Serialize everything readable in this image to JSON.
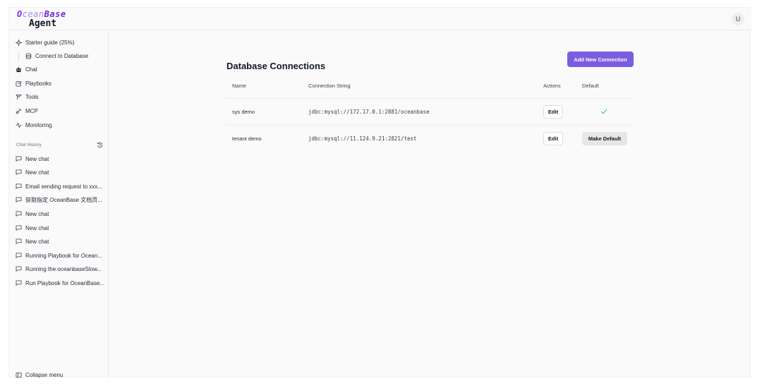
{
  "brand": {
    "logo_part1": "O",
    "logo_part2": "cean",
    "logo_part3": "Base",
    "logo_sub": "Agent",
    "accent": "#7c5ce0"
  },
  "user": {
    "avatar_initial": "U"
  },
  "sidebar": {
    "nav": [
      {
        "label": "Starter guide (25%)",
        "icon": "sparkle-icon"
      },
      {
        "label": "Connect to Database",
        "icon": "database-icon"
      },
      {
        "label": "Chat",
        "icon": "bot-icon"
      },
      {
        "label": "Playbooks",
        "icon": "playbook-icon"
      },
      {
        "label": "Tools",
        "icon": "tools-icon"
      },
      {
        "label": "MCP",
        "icon": "plug-icon"
      },
      {
        "label": "Monitoring",
        "icon": "activity-icon"
      }
    ],
    "history_label": "Chat History",
    "history": [
      "New chat",
      "New chat",
      "Email sending request to xxx...",
      "获取指定 OceanBase 文档页...",
      "New chat",
      "New chat",
      "New chat",
      "Running Playbook for Ocean...",
      "Running the oceanbaseSlow...",
      "Run Playbook for OceanBase..."
    ],
    "collapse_label": "Collapse menu"
  },
  "main": {
    "title": "Database Connections",
    "add_button": "Add New Connection",
    "columns": {
      "name": "Name",
      "connection_string": "Connection String",
      "actions": "Actions",
      "default": "Default"
    },
    "rows": [
      {
        "name": "sys demo",
        "connection_string": "jdbc:mysql://172.17.0.1:2881/oceanbase",
        "action": "Edit",
        "is_default": true
      },
      {
        "name": "tenant demo",
        "connection_string": "jdbc:mysql://11.124.9.21:2821/test",
        "action": "Edit",
        "is_default": false,
        "default_button": "Make Default"
      }
    ],
    "check_color": "#22c55e"
  }
}
